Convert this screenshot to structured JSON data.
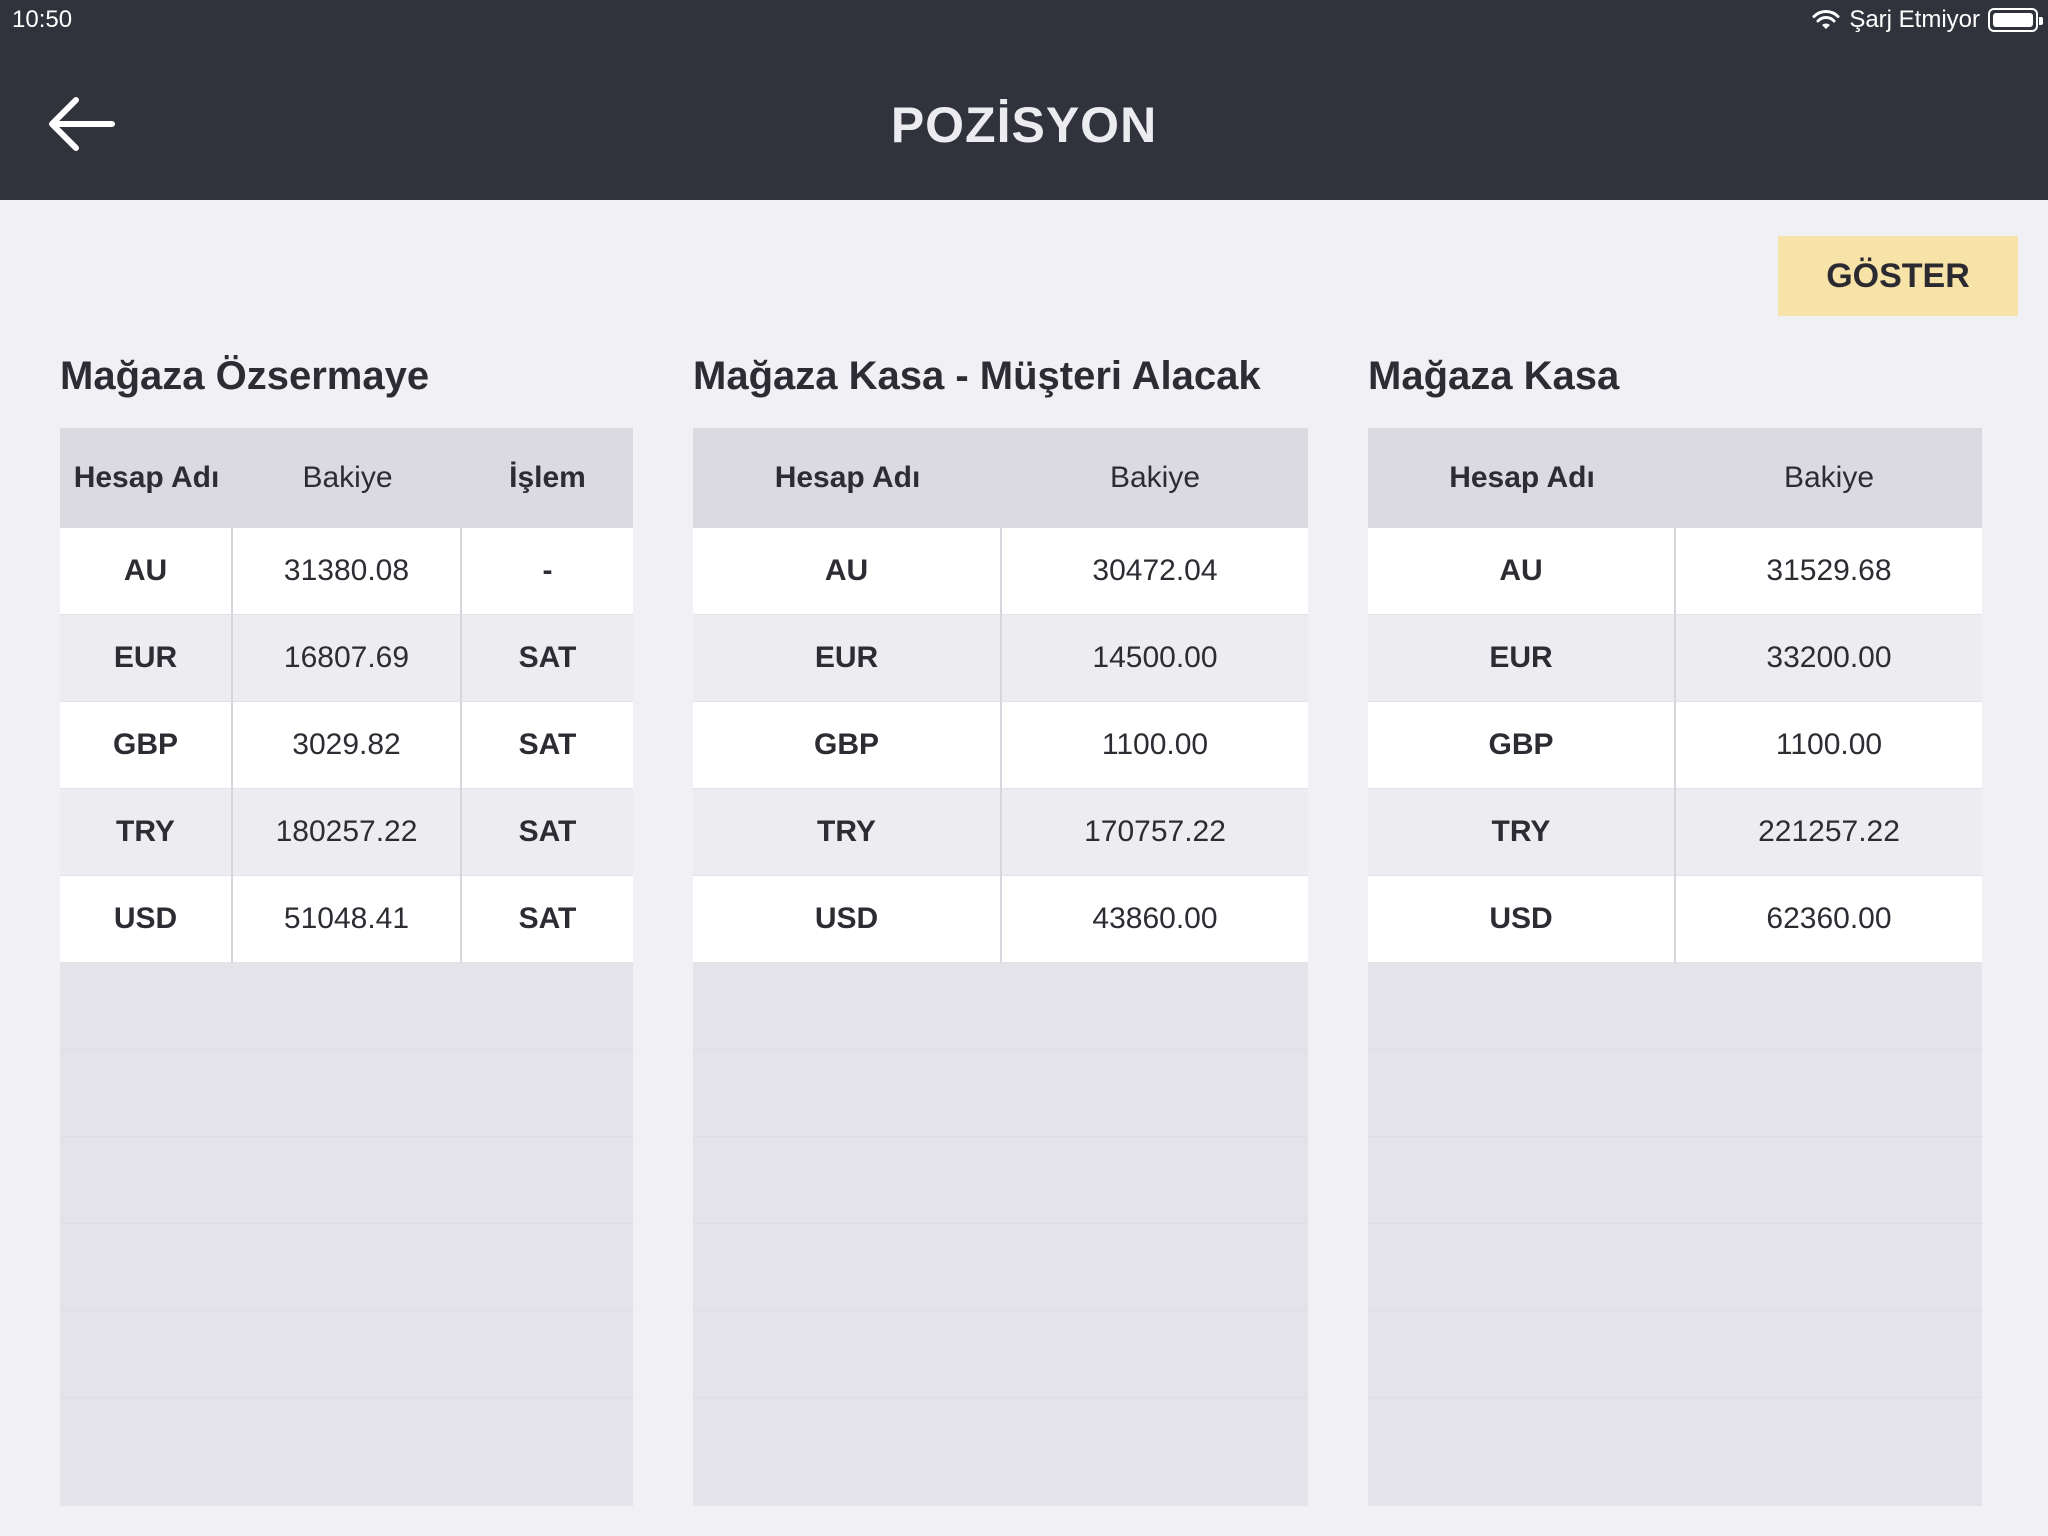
{
  "status_bar": {
    "time": "10:50",
    "charging_text": "Şarj Etmiyor",
    "icons": [
      "wifi-icon",
      "battery-icon"
    ]
  },
  "header": {
    "title": "POZİSYON",
    "back_icon": "back-arrow-icon"
  },
  "actions": {
    "show_label": "GÖSTER"
  },
  "colors": {
    "header_bg": "#31333c",
    "page_bg": "#f0f0f5",
    "button_bg": "#f7e2a7",
    "table_header_bg": "#dadae0"
  },
  "panels": [
    {
      "title": "Mağaza Özsermaye",
      "headers": [
        "Hesap Adı",
        "Bakiye",
        "İşlem"
      ],
      "rows": [
        [
          "AU",
          "31380.08",
          "-"
        ],
        [
          "EUR",
          "16807.69",
          "SAT"
        ],
        [
          "GBP",
          "3029.82",
          "SAT"
        ],
        [
          "TRY",
          "180257.22",
          "SAT"
        ],
        [
          "USD",
          "51048.41",
          "SAT"
        ]
      ]
    },
    {
      "title": "Mağaza Kasa - Müşteri Alacak",
      "headers": [
        "Hesap Adı",
        "Bakiye"
      ],
      "rows": [
        [
          "AU",
          "30472.04"
        ],
        [
          "EUR",
          "14500.00"
        ],
        [
          "GBP",
          "1100.00"
        ],
        [
          "TRY",
          "170757.22"
        ],
        [
          "USD",
          "43860.00"
        ]
      ]
    },
    {
      "title": "Mağaza Kasa",
      "headers": [
        "Hesap Adı",
        "Bakiye"
      ],
      "rows": [
        [
          "AU",
          "31529.68"
        ],
        [
          "EUR",
          "33200.00"
        ],
        [
          "GBP",
          "1100.00"
        ],
        [
          "TRY",
          "221257.22"
        ],
        [
          "USD",
          "62360.00"
        ]
      ]
    }
  ]
}
